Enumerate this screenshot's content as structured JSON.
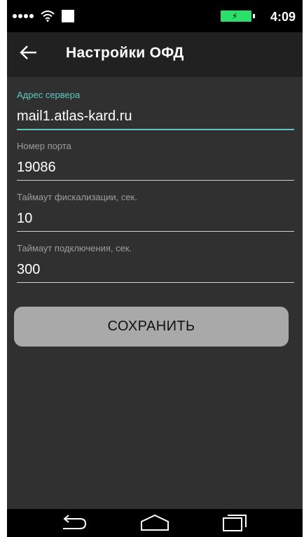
{
  "statusbar": {
    "time": "4:09",
    "icons": [
      "signal-dots-icon",
      "wifi-icon",
      "notification-square-icon",
      "battery-charging-icon"
    ],
    "battery_color": "#2ae06a"
  },
  "appbar": {
    "back_icon": "arrow-left-icon",
    "title": "Настройки ОФД"
  },
  "form": {
    "server": {
      "label": "Адрес сервера",
      "value": "mail1.atlas-kard.ru"
    },
    "port": {
      "label": "Номер порта",
      "value": "19086"
    },
    "fiscal_timeout": {
      "label": "Таймаут фискализации, сек.",
      "value": "10"
    },
    "connect_timeout": {
      "label": "Таймаут подключения, сек.",
      "value": "300"
    },
    "save_label": "СОХРАНИТЬ"
  },
  "navbar": {
    "icons": [
      "back-nav-icon",
      "home-nav-icon",
      "recents-nav-icon"
    ]
  },
  "colors": {
    "accent": "#5fc7c0",
    "background": "#303030",
    "appbar": "#212121",
    "button": "#a9a9a9"
  }
}
